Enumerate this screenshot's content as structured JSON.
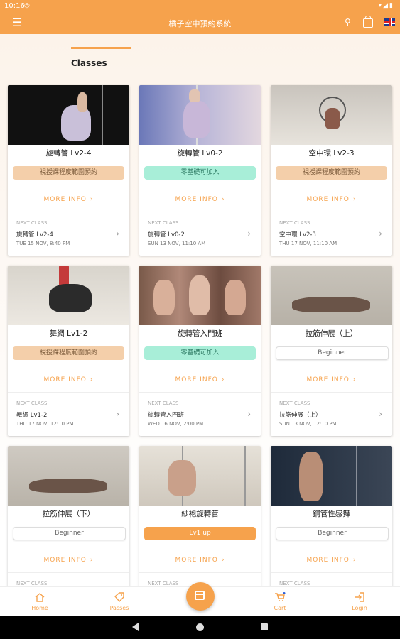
{
  "status_bar": {
    "time": "10:16"
  },
  "app_bar": {
    "title": "橘子空中預約系統",
    "icons": [
      "menu-icon",
      "search-icon",
      "shopping-bag-icon",
      "uk-flag-icon"
    ]
  },
  "tabs": {
    "active": "Classes"
  },
  "next_class_label": "NEXT CLASS",
  "more_info_label": "MORE INFO",
  "classes": [
    {
      "title": "旋轉管 Lv2-4",
      "tag": "視授課程度範圍預約",
      "next_name": "旋轉管 Lv2-4",
      "next_time": "TUE 15 NOV, 8:40 PM"
    },
    {
      "title": "旋轉管 Lv0-2",
      "tag": "零基礎可加入",
      "next_name": "旋轉管 Lv0-2",
      "next_time": "SUN 13 NOV, 11:10 AM"
    },
    {
      "title": "空中環 Lv2-3",
      "tag": "視授課程度範圍預約",
      "next_name": "空中環 Lv2-3",
      "next_time": "THU 17 NOV, 11:10 AM"
    },
    {
      "title": "舞綢 Lv1-2",
      "tag": "視授課程度範圍預約",
      "next_name": "舞綢 Lv1-2",
      "next_time": "THU 17 NOV, 12:10 PM"
    },
    {
      "title": "旋轉管入門班",
      "tag": "零基礎可加入",
      "next_name": "旋轉管入門班",
      "next_time": "WED 16 NOV, 2:00 PM"
    },
    {
      "title": "拉筋伸展（上）",
      "tag": "Beginner",
      "next_name": "拉筋伸展（上）",
      "next_time": "SUN 13 NOV, 12:10 PM"
    },
    {
      "title": "拉筋伸展（下）",
      "tag": "Beginner"
    },
    {
      "title": "紗袍旋轉管",
      "tag": "Lv1 up"
    },
    {
      "title": "鋼管性感舞",
      "tag": "Beginner"
    }
  ],
  "bottom_nav": {
    "home": "Home",
    "passes": "Passes",
    "cart": "Cart",
    "login": "Login"
  }
}
